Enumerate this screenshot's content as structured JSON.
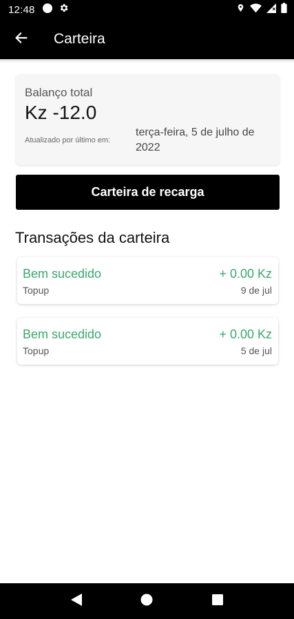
{
  "status_bar": {
    "time": "12:48"
  },
  "app_bar": {
    "title": "Carteira"
  },
  "balance": {
    "label": "Balanço total",
    "value": "Kz -12.0",
    "updated_label": "Atualizado por último em:",
    "updated_value": "terça-feira, 5 de julho de 2022"
  },
  "recharge_button": {
    "label": "Carteira de recarga"
  },
  "transactions": {
    "title": "Transações da carteira",
    "items": [
      {
        "status": "Bem sucedido",
        "type": "Topup",
        "amount": "+ 0.00 Kz",
        "date": "9 de jul"
      },
      {
        "status": "Bem sucedido",
        "type": "Topup",
        "amount": "+ 0.00 Kz",
        "date": "5 de jul"
      }
    ]
  },
  "colors": {
    "success": "#3aa76d",
    "bar": "#000000"
  }
}
